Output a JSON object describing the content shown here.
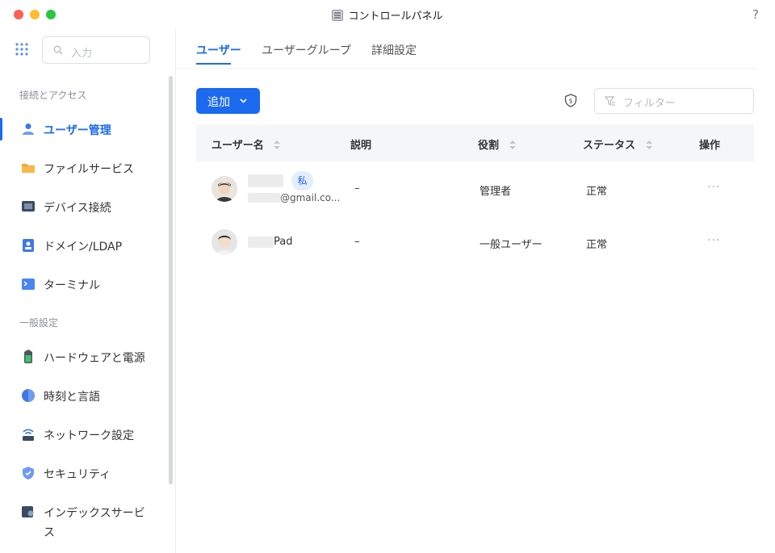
{
  "window": {
    "title": "コントロールパネル",
    "help": "?"
  },
  "sidebar": {
    "search_placeholder": "入力",
    "sections": [
      {
        "label": "接続とアクセス"
      },
      {
        "label": "一般設定"
      }
    ],
    "items": [
      {
        "label": "ユーザー管理",
        "icon": "user-manage-icon"
      },
      {
        "label": "ファイルサービス",
        "icon": "folder-icon"
      },
      {
        "label": "デバイス接続",
        "icon": "device-icon"
      },
      {
        "label": "ドメイン/LDAP",
        "icon": "domain-icon"
      },
      {
        "label": "ターミナル",
        "icon": "terminal-icon"
      },
      {
        "label": "ハードウェアと電源",
        "icon": "battery-icon"
      },
      {
        "label": "時刻と言語",
        "icon": "globe-icon"
      },
      {
        "label": "ネットワーク設定",
        "icon": "network-icon"
      },
      {
        "label": "セキュリティ",
        "icon": "shield-icon"
      },
      {
        "label": "インデックスサービ",
        "label2": "ス",
        "icon": "index-icon"
      }
    ]
  },
  "tabs": [
    {
      "label": "ユーザー"
    },
    {
      "label": "ユーザーグループ"
    },
    {
      "label": "詳細設定"
    }
  ],
  "toolbar": {
    "add_label": "追加",
    "filter_placeholder": "フィルター"
  },
  "table": {
    "columns": [
      "ユーザー名",
      "説明",
      "役割",
      "ステータス",
      "操作"
    ],
    "rows": [
      {
        "name": "",
        "badge": "私",
        "email": "@gmail.co...",
        "description": "–",
        "role": "管理者",
        "status": "正常",
        "actions": "···"
      },
      {
        "name": "Pad",
        "description": "–",
        "role": "一般ユーザー",
        "status": "正常",
        "actions": "···"
      }
    ]
  },
  "colors": {
    "accent": "#1b6af0"
  }
}
